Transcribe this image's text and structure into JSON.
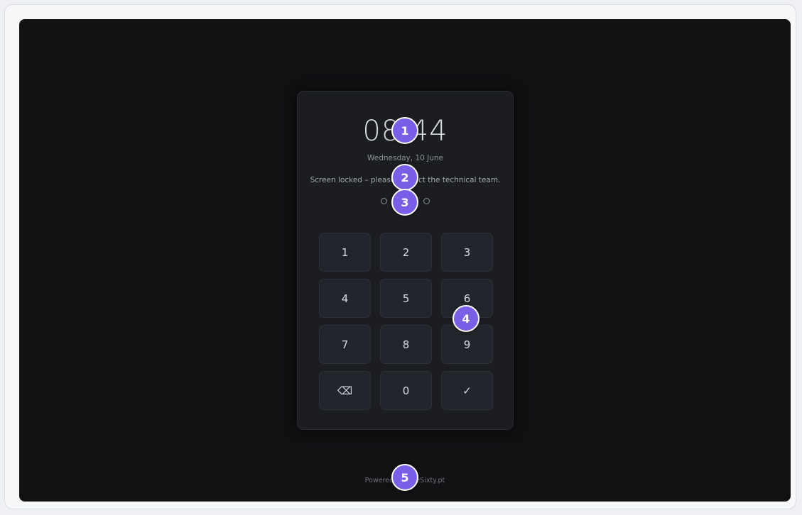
{
  "lock_screen": {
    "time": "08:44",
    "date": "Wednesday, 10 June",
    "message": "Screen locked – please contact the technical team.",
    "pin_length": 4,
    "pin_entered": 0
  },
  "keypad": {
    "keys": [
      "1",
      "2",
      "3",
      "4",
      "5",
      "6",
      "7",
      "8",
      "9",
      "⌫",
      "0",
      "✓"
    ]
  },
  "footer": {
    "text": "Powered by OneSixty.pt"
  },
  "annotations": [
    "1",
    "2",
    "3",
    "4",
    "5"
  ],
  "colors": {
    "screen_bg": "#111114",
    "card_bg": "#1b1d21",
    "key_bg": "#22252b",
    "badge": "#7b5ee8"
  }
}
